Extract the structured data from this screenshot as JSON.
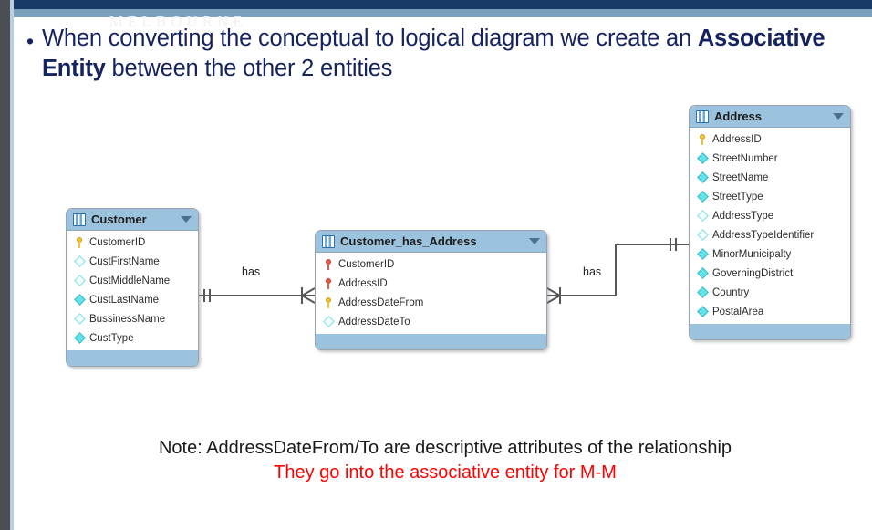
{
  "slide": {
    "watermark": "MELBOURNE",
    "bullet": {
      "marker": "•",
      "text_before": "When converting the conceptual to logical diagram we create an ",
      "text_bold": "Associative Entity",
      "text_after": " between the other 2 entities"
    },
    "note": {
      "line1": "Note:  AddressDateFrom/To are descriptive attributes of the relationship",
      "line2": "They go into the associative entity for M-M"
    }
  },
  "theme": {
    "header_fill": "#9cc3de",
    "box_border": "#9aa3ad",
    "bullet_text": "#15235e",
    "note_red": "#fe0000",
    "top_navy": "#1a3a66",
    "top_steel": "#7ba0bb",
    "rail": "#4b4f54",
    "pk_key": "#f2c230",
    "fk_key": "#e8544a",
    "diamond_filled": "#63e2ea",
    "diamond_hollow": "#f2fdfe"
  },
  "entities": [
    {
      "id": "customer",
      "title": "Customer",
      "icon": "table-icon",
      "caret": "chevron-down-icon",
      "attributes": [
        {
          "name": "CustomerID",
          "glyph": "key-icon",
          "glyph_color": "#f2c230"
        },
        {
          "name": "CustFirstName",
          "glyph": "diamond-hollow-icon"
        },
        {
          "name": "CustMiddleName",
          "glyph": "diamond-hollow-icon"
        },
        {
          "name": "CustLastName",
          "glyph": "diamond-filled-icon"
        },
        {
          "name": "BussinessName",
          "glyph": "diamond-hollow-icon"
        },
        {
          "name": "CustType",
          "glyph": "diamond-filled-icon"
        }
      ]
    },
    {
      "id": "customer_has_address",
      "title": "Customer_has_Address",
      "icon": "table-icon",
      "caret": "chevron-down-icon",
      "attributes": [
        {
          "name": "CustomerID",
          "glyph": "key-icon",
          "glyph_color": "#e8544a"
        },
        {
          "name": "AddressID",
          "glyph": "key-icon",
          "glyph_color": "#e8544a"
        },
        {
          "name": "AddressDateFrom",
          "glyph": "key-icon",
          "glyph_color": "#f2c230"
        },
        {
          "name": "AddressDateTo",
          "glyph": "diamond-hollow-icon"
        }
      ]
    },
    {
      "id": "address",
      "title": "Address",
      "icon": "table-icon",
      "caret": "chevron-down-icon",
      "attributes": [
        {
          "name": "AddressID",
          "glyph": "key-icon",
          "glyph_color": "#f2c230"
        },
        {
          "name": "StreetNumber",
          "glyph": "diamond-filled-icon"
        },
        {
          "name": "StreetName",
          "glyph": "diamond-filled-icon"
        },
        {
          "name": "StreetType",
          "glyph": "diamond-filled-icon"
        },
        {
          "name": "AddressType",
          "glyph": "diamond-hollow-icon"
        },
        {
          "name": "AddressTypeIdentifier",
          "glyph": "diamond-hollow-icon"
        },
        {
          "name": "MinorMunicipalty",
          "glyph": "diamond-filled-icon"
        },
        {
          "name": "GoverningDistrict",
          "glyph": "diamond-filled-icon"
        },
        {
          "name": "Country",
          "glyph": "diamond-filled-icon"
        },
        {
          "name": "PostalArea",
          "glyph": "diamond-filled-icon"
        }
      ]
    }
  ],
  "relationships": [
    {
      "id": "customer-to-assoc",
      "label": "has",
      "from": "customer",
      "to": "customer_has_address",
      "from_cardinality": "one-and-only-one",
      "to_cardinality": "many"
    },
    {
      "id": "assoc-to-address",
      "label": "has",
      "from": "customer_has_address",
      "to": "address",
      "from_cardinality": "many",
      "to_cardinality": "one-and-only-one"
    }
  ]
}
